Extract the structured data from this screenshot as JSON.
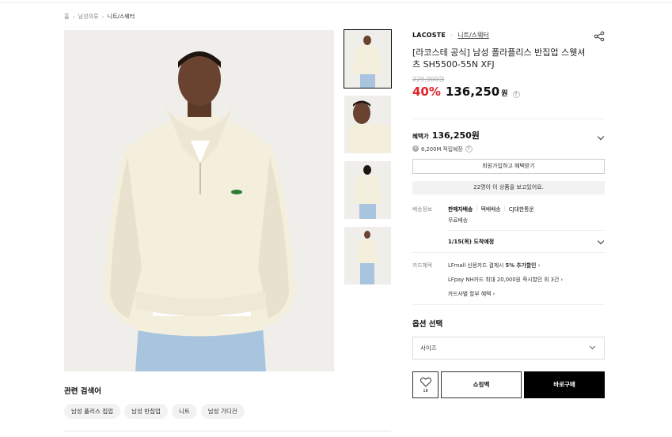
{
  "breadcrumb": [
    "홈",
    "남성의류",
    "니트/스웨터"
  ],
  "product": {
    "brand": "LACOSTE",
    "category": "니트/스웨터",
    "title": "[라코스테 공식] 남성 폴라플리스 반집업 스웻셔츠 SH5500-55N XFJ",
    "original_price": "229,000원",
    "discount": "40%",
    "price": "136,250",
    "won": "원"
  },
  "benefit": {
    "label": "혜택가",
    "price": "136,250원",
    "points_icon": "Ⓜ",
    "points": "6,200M 적립예정",
    "join_button": "회원가입하고 혜택받기"
  },
  "viewing_notice": "22명이 이 상품을 보고있어요.",
  "shipping": {
    "label": "배송정보",
    "method": "판매자배송",
    "type": "택배배송",
    "carrier": "CJ대한통운",
    "fee": "무료배송",
    "arrival": "1/15(목) 도착예정"
  },
  "card": {
    "label": "카드혜택",
    "line1_pre": "LFmall 신용카드 결제시 ",
    "line1_bold": "5% 추가할인",
    "line2": "LFpay NH카드 최대 20,000원 즉시할인 외 3건",
    "line3": "카드사별 할부 혜택"
  },
  "options": {
    "title": "옵션 선택",
    "size_placeholder": "사이즈"
  },
  "actions": {
    "like_count": "18",
    "bag": "쇼핑백",
    "buy": "바로구매"
  },
  "related": {
    "title": "관련 검색어",
    "tags": [
      "남성 플리스 집업",
      "남성 반집업",
      "니트",
      "남성 가디건"
    ]
  },
  "icons": {
    "share": "share-icon",
    "heart": "heart-icon",
    "question": "?"
  },
  "colors": {
    "discount": "#e1242b",
    "buy_button": "#000000"
  }
}
